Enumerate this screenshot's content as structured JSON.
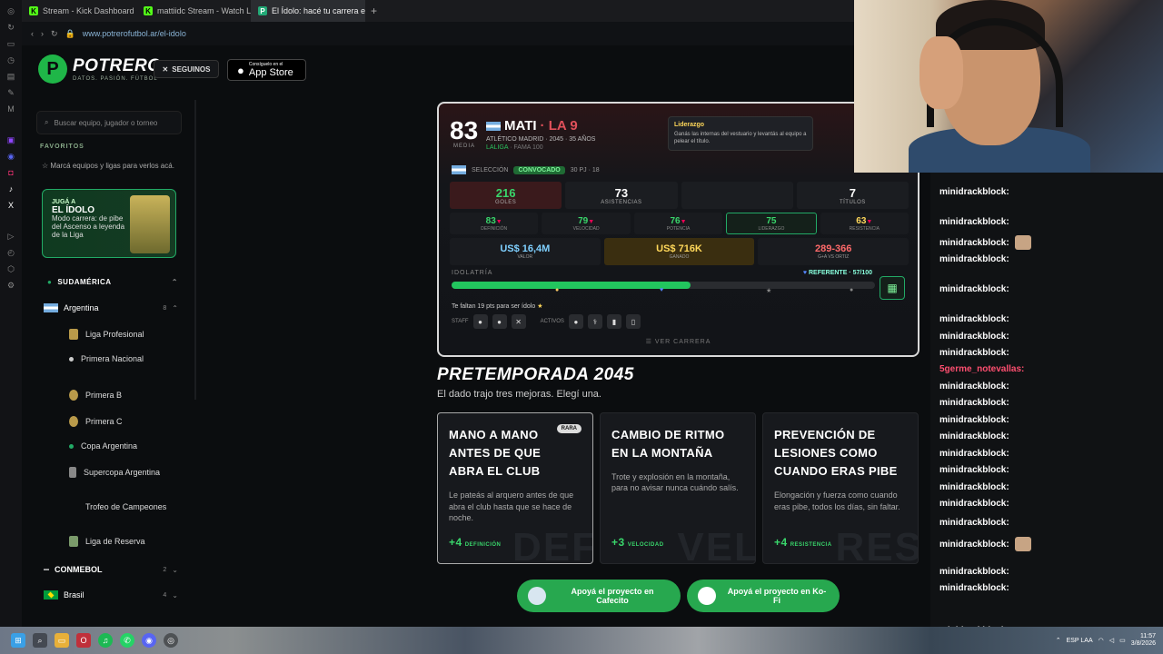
{
  "browser": {
    "tabs": [
      {
        "label": "Stream - Kick Dashboard",
        "icon": "kick-icon"
      },
      {
        "label": "mattiidc Stream - Watch L",
        "icon": "kick-icon"
      },
      {
        "label": "El Ídolo: hacé tu carrera en",
        "icon": "potrero-icon"
      }
    ],
    "new_tab": "+",
    "url": "www.potrerofutbol.ar/el-idolo"
  },
  "site": {
    "logo_text": "POTRERO",
    "logo_tag": "DATOS. PASIÓN. FÚTBOL",
    "follow_label": "SEGUINOS",
    "appstore_small": "Consíguelo en el",
    "appstore_large": "App Store",
    "search_placeholder": "Buscar equipo, jugador o torneo",
    "favorites_title": "FAVORITOS",
    "favorites_hint": "Marcá equipos y ligas para verlos acá.",
    "idolo_card": {
      "kicker": "JUGÁ A",
      "title": "EL ÍDOLO",
      "desc": "Modo carrera: de pibe del Ascenso a leyenda de la Liga"
    },
    "region": "SUDAMÉRICA",
    "country_ar": {
      "name": "Argentina",
      "count": "8"
    },
    "leagues": [
      "Liga Profesional",
      "Primera Nacional",
      "Primera B",
      "Primera C",
      "Copa Argentina",
      "Supercopa Argentina",
      "Trofeo de Campeones",
      "Liga de Reserva"
    ],
    "conmebol": {
      "name": "CONMEBOL",
      "count": "2"
    },
    "brasil": {
      "name": "Brasil",
      "count": "4"
    }
  },
  "player": {
    "overall": "83",
    "media_label": "MEDIA",
    "name": "MATI",
    "nickname": "LA 9",
    "club_line": "ATLÉTICO MADRID · 2045 · 35 AÑOS",
    "league": "LALIGA",
    "fame": "FAMA 100",
    "seleccion_label": "SELECCIÓN",
    "seleccion_status": "CONVOCADO",
    "seleccion_extra": "30 PJ · 18",
    "stats": [
      {
        "value": "216",
        "label": "GOLES"
      },
      {
        "value": "73",
        "label": "ASISTENCIAS"
      },
      {
        "value": "",
        "label": ""
      },
      {
        "value": "7",
        "label": "TÍTULOS"
      }
    ],
    "attributes": [
      {
        "value": "83",
        "label": "DEFINICIÓN",
        "color": "#39d66b"
      },
      {
        "value": "79",
        "label": "VELOCIDAD",
        "color": "#39d66b"
      },
      {
        "value": "76",
        "label": "POTENCIA",
        "color": "#39d66b"
      },
      {
        "value": "75",
        "label": "LIDERAZGO",
        "color": "#39d66b"
      },
      {
        "value": "63",
        "label": "RESISTENCIA",
        "color": "#ffd85a"
      }
    ],
    "money": [
      {
        "value": "US$ 16,4M",
        "label": "VALOR"
      },
      {
        "value": "US$ 716K",
        "label": "GANADO"
      },
      {
        "value": "289-366",
        "label": "G+A VS ORTIZ"
      }
    ],
    "idolatria_label": "IDOLATRÍA",
    "referente": "REFERENTE · 57/100",
    "idolatria_fraction": 0.57,
    "need_text": "Te faltan 19 pts para ser ídolo",
    "staff_label": "STAFF",
    "activos_label": "ACTIVOS",
    "ver_carrera": "VER CARRERA"
  },
  "tooltip": {
    "title": "Liderazgo",
    "desc": "Ganás las internas del vestuario y levantás al equipo a pelear el título."
  },
  "pretemporada": {
    "title": "PRETEMPORADA 2045",
    "subtitle": "El dado trajo tres mejoras. Elegí una.",
    "cards": [
      {
        "title": "MANO A MANO ANTES DE QUE ABRA EL CLUB",
        "desc": "Le pateás al arquero antes de que abra el club hasta que se hace de noche.",
        "gain": "+4",
        "attr": "DEFINICIÓN",
        "ghost": "DEF",
        "badge": "RARA"
      },
      {
        "title": "CAMBIO DE RITMO EN LA MONTAÑA",
        "desc": "Trote y explosión en la montaña, para no avisar nunca cuándo salís.",
        "gain": "+3",
        "attr": "VELOCIDAD",
        "ghost": "VEL",
        "badge": ""
      },
      {
        "title": "PREVENCIÓN DE LESIONES COMO CUANDO ERAS PIBE",
        "desc": "Elongación y fuerza como cuando eras pibe, todos los días, sin faltar.",
        "gain": "+4",
        "attr": "RESISTENCIA",
        "ghost": "RES",
        "badge": ""
      }
    ]
  },
  "donate": {
    "cafecito": "Apoyá el proyecto en Cafecito",
    "kofi": "Apoyá el proyecto en Ko-Fi"
  },
  "chat": {
    "messages": [
      {
        "user": "minidrackblock:",
        "emote": false
      },
      {
        "user": "minidrackblock:",
        "emote": false
      },
      {
        "user": "minidrackblock:",
        "emote": true
      },
      {
        "user": "minidrackblock:",
        "emote": false
      },
      {
        "user": "minidrackblock:",
        "emote": false
      },
      {
        "user": "minidrackblock:",
        "emote": false
      },
      {
        "user": "minidrackblock:",
        "emote": false
      },
      {
        "user": "minidrackblock:",
        "emote": false
      },
      {
        "user": "5germe_notevallas:",
        "emote": false,
        "pink": true
      },
      {
        "user": "minidrackblock:",
        "emote": false
      },
      {
        "user": "minidrackblock:",
        "emote": false
      },
      {
        "user": "minidrackblock:",
        "emote": false
      },
      {
        "user": "minidrackblock:",
        "emote": false
      },
      {
        "user": "minidrackblock:",
        "emote": false
      },
      {
        "user": "minidrackblock:",
        "emote": false
      },
      {
        "user": "minidrackblock:",
        "emote": false
      },
      {
        "user": "minidrackblock:",
        "emote": false
      },
      {
        "user": "minidrackblock:",
        "emote": false
      },
      {
        "user": "minidrackblock:",
        "emote": true
      },
      {
        "user": "minidrackblock:",
        "emote": false
      },
      {
        "user": "minidrackblock:",
        "emote": false
      },
      {
        "user": "minidrackblock:",
        "emote": false
      },
      {
        "user": "minidrackblock:",
        "emote": false
      }
    ]
  },
  "taskbar": {
    "lang": "ESP LAA",
    "time": "11:57",
    "date": "3/8/2026"
  }
}
